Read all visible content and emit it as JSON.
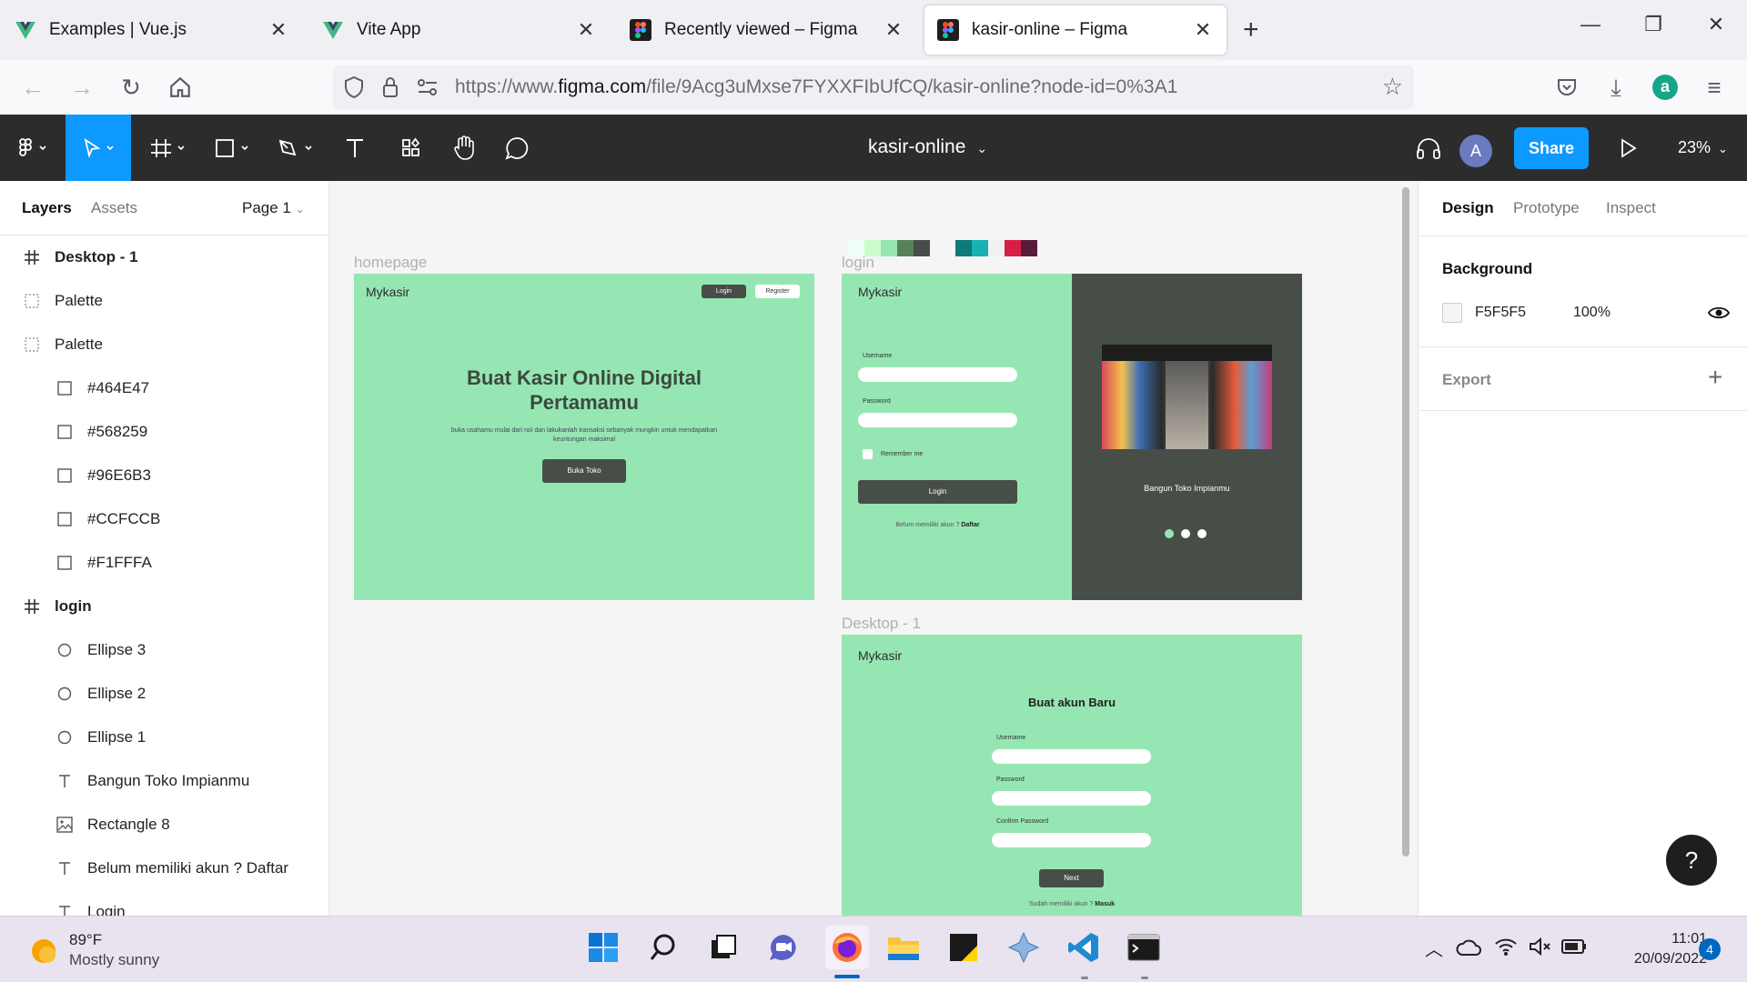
{
  "browser": {
    "tabs": [
      {
        "title": "Examples | Vue.js",
        "active": false
      },
      {
        "title": "Vite App",
        "active": false
      },
      {
        "title": "Recently viewed – Figma",
        "active": false
      },
      {
        "title": "kasir-online – Figma",
        "active": true
      }
    ],
    "url_prefix": "https://www.",
    "url_domain": "figma.com",
    "url_rest": "/file/9Acg3uMxse7FYXXFIbUfCQ/kasir-online?node-id=0%3A1",
    "profile_initial": "a"
  },
  "figma": {
    "file_title": "kasir-online",
    "share_label": "Share",
    "user_initial": "A",
    "zoom": "23%"
  },
  "left_panel": {
    "tab_layers": "Layers",
    "tab_assets": "Assets",
    "page_select": "Page 1",
    "layers": [
      {
        "name": "Desktop - 1",
        "icon": "frame-icon",
        "level": 0
      },
      {
        "name": "Palette",
        "icon": "group-icon",
        "level": 0
      },
      {
        "name": "Palette",
        "icon": "group-icon",
        "level": 0
      },
      {
        "name": "#464E47",
        "icon": "rectangle-icon",
        "level": 1
      },
      {
        "name": "#568259",
        "icon": "rectangle-icon",
        "level": 1
      },
      {
        "name": "#96E6B3",
        "icon": "rectangle-icon",
        "level": 1
      },
      {
        "name": "#CCFCCB",
        "icon": "rectangle-icon",
        "level": 1
      },
      {
        "name": "#F1FFFA",
        "icon": "rectangle-icon",
        "level": 1
      },
      {
        "name": "login",
        "icon": "frame-icon",
        "level": 0
      },
      {
        "name": "Ellipse 3",
        "icon": "ellipse-icon",
        "level": 1
      },
      {
        "name": "Ellipse 2",
        "icon": "ellipse-icon",
        "level": 1
      },
      {
        "name": "Ellipse 1",
        "icon": "ellipse-icon",
        "level": 1
      },
      {
        "name": "Bangun Toko Impianmu",
        "icon": "text-icon",
        "level": 1
      },
      {
        "name": "Rectangle 8",
        "icon": "image-icon",
        "level": 1
      },
      {
        "name": "Belum memiliki akun ? Daftar",
        "icon": "text-icon",
        "level": 1
      },
      {
        "name": "Login",
        "icon": "text-icon",
        "level": 1
      }
    ]
  },
  "canvas": {
    "palette_colors_1": [
      "#F1FFFA",
      "#CCFCCB",
      "#96E6B3",
      "#568259",
      "#464E47"
    ],
    "palette_colors_2": [
      "#0e7a7a",
      "#17b3b3",
      "#f1f1f1",
      "#d81e46",
      "#5a1a3a"
    ],
    "homepage": {
      "label": "homepage",
      "brand": "Mykasir",
      "login_btn": "Login",
      "register_btn": "Register",
      "headline": "Buat Kasir Online Digital Pertamamu",
      "subtext": "buka usahamu mulai dari nol dan lakukanlah transaksi sebanyak mungkin untuk mendapatkan keuntungan maksimal",
      "cta": "Buka Toko"
    },
    "login": {
      "label": "login",
      "brand": "Mykasir",
      "username_label": "Username",
      "password_label": "Password",
      "remember_label": "Remember me",
      "login_btn": "Login",
      "signup_prompt": "Belum memiliki akun ? ",
      "signup_link": "Daftar",
      "side_title": "Bangun Toko Impianmu"
    },
    "register": {
      "label": "Desktop - 1",
      "brand": "Mykasir",
      "title": "Buat akun Baru",
      "username_label": "Username",
      "password_label": "Password",
      "confirm_label": "Confirm Password",
      "next_btn": "Next",
      "login_prompt": "Sudah memiliki akun ? ",
      "login_link": "Masuk"
    }
  },
  "right_panel": {
    "tab_design": "Design",
    "tab_prototype": "Prototype",
    "tab_inspect": "Inspect",
    "background_label": "Background",
    "background_hex": "F5F5F5",
    "background_opacity": "100%",
    "export_label": "Export",
    "help": "?"
  },
  "taskbar": {
    "weather_temp": "89°F",
    "weather_desc": "Mostly sunny",
    "time": "11:01",
    "date": "20/09/2022",
    "notifications": "4"
  }
}
